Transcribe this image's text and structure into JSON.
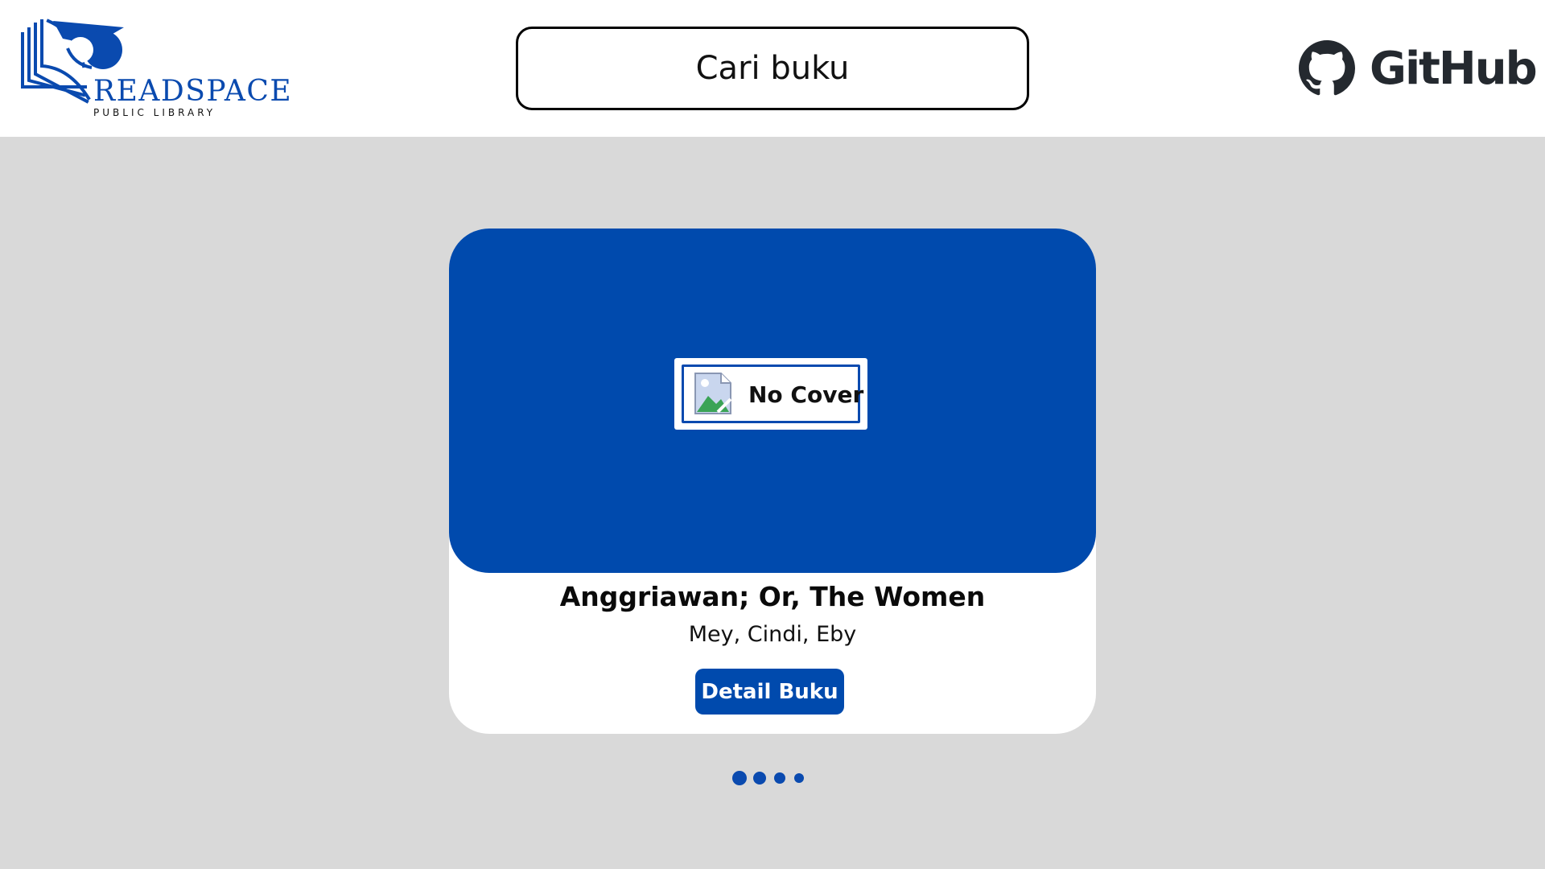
{
  "header": {
    "logo": {
      "title": "READSPACE",
      "subtitle": "PUBLIC LIBRARY"
    },
    "search": {
      "placeholder": "Cari buku",
      "value": ""
    },
    "github": {
      "label": "GitHub",
      "icon": "github-icon"
    }
  },
  "carousel": {
    "book": {
      "cover_placeholder": "No Cover",
      "cover_icon": "broken-image-icon",
      "title": "Anggriawan; Or, The Women",
      "authors": "Mey, Cindi, Eby",
      "detail_button": "Detail Buku"
    },
    "page_count": 4
  },
  "colors": {
    "brand": "#004aad",
    "background": "#d9d9d9",
    "header": "#ffffff",
    "card": "#ffffff",
    "github": "#24292f"
  }
}
